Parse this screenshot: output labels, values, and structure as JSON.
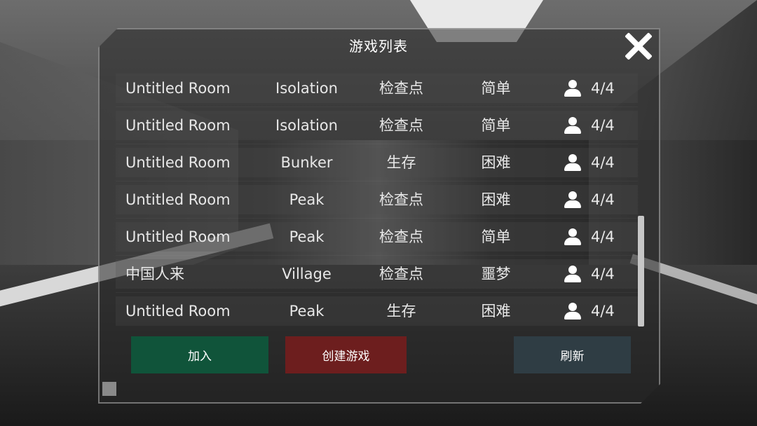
{
  "window": {
    "title": "游戏列表"
  },
  "rooms": [
    {
      "name": "Untitled Room",
      "map": "Isolation",
      "mode": "检查点",
      "difficulty": "简单",
      "players": "4/4"
    },
    {
      "name": "Untitled Room",
      "map": "Isolation",
      "mode": "检查点",
      "difficulty": "简单",
      "players": "4/4"
    },
    {
      "name": "Untitled Room",
      "map": "Bunker",
      "mode": "生存",
      "difficulty": "困难",
      "players": "4/4"
    },
    {
      "name": "Untitled Room",
      "map": "Peak",
      "mode": "检查点",
      "difficulty": "困难",
      "players": "4/4"
    },
    {
      "name": "Untitled Room",
      "map": "Peak",
      "mode": "检查点",
      "difficulty": "简单",
      "players": "4/4"
    },
    {
      "name": "中国人来",
      "map": "Village",
      "mode": "检查点",
      "difficulty": "噩梦",
      "players": "4/4"
    },
    {
      "name": "Untitled Room",
      "map": "Peak",
      "mode": "生存",
      "difficulty": "困难",
      "players": "4/4"
    }
  ],
  "buttons": {
    "join_label": "加入",
    "create_label": "创建游戏",
    "refresh_label": "刷新"
  },
  "icons": {
    "close": "close-icon",
    "player": "user-icon"
  },
  "colors": {
    "join": "#10543a",
    "create": "#6d1e1e",
    "refresh": "#2f3d44"
  }
}
